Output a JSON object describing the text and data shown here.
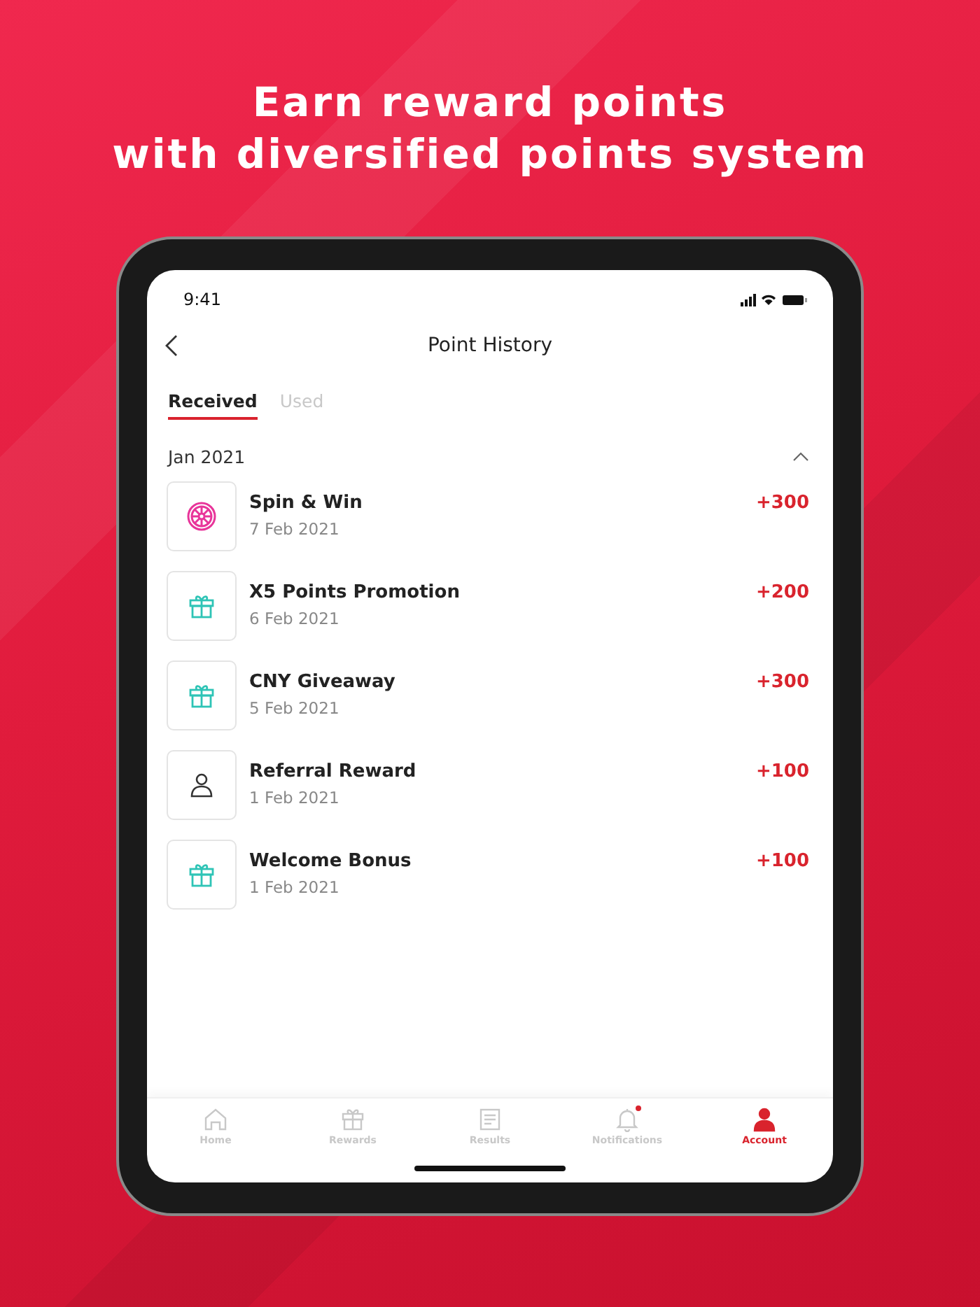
{
  "headline": [
    "Earn reward points",
    "with diversified points system"
  ],
  "status_bar": {
    "time": "9:41"
  },
  "header": {
    "title": "Point History"
  },
  "tabs": [
    {
      "label": "Received",
      "selected": true
    },
    {
      "label": "Used",
      "selected": false
    }
  ],
  "section": {
    "title": "Jan 2021",
    "expanded": true
  },
  "entries": [
    {
      "kind": "wheel",
      "title": "Spin & Win",
      "date": "7 Feb 2021",
      "points": "+300"
    },
    {
      "kind": "gift",
      "title": "X5 Points Promotion",
      "date": "6 Feb 2021",
      "points": "+200"
    },
    {
      "kind": "gift",
      "title": "CNY Giveaway",
      "date": "5 Feb 2021",
      "points": "+300"
    },
    {
      "kind": "person",
      "title": "Referral Reward",
      "date": "1 Feb 2021",
      "points": "+100"
    },
    {
      "kind": "gift",
      "title": "Welcome Bonus",
      "date": "1 Feb 2021",
      "points": "+100"
    }
  ],
  "nav": [
    {
      "kind": "home",
      "label": "Home",
      "selected": false,
      "badge": false
    },
    {
      "kind": "gift",
      "label": "Rewards",
      "selected": false,
      "badge": false
    },
    {
      "kind": "results",
      "label": "Results",
      "selected": false,
      "badge": false
    },
    {
      "kind": "bell",
      "label": "Notifications",
      "selected": false,
      "badge": true
    },
    {
      "kind": "person",
      "label": "Account",
      "selected": true,
      "badge": false
    }
  ]
}
